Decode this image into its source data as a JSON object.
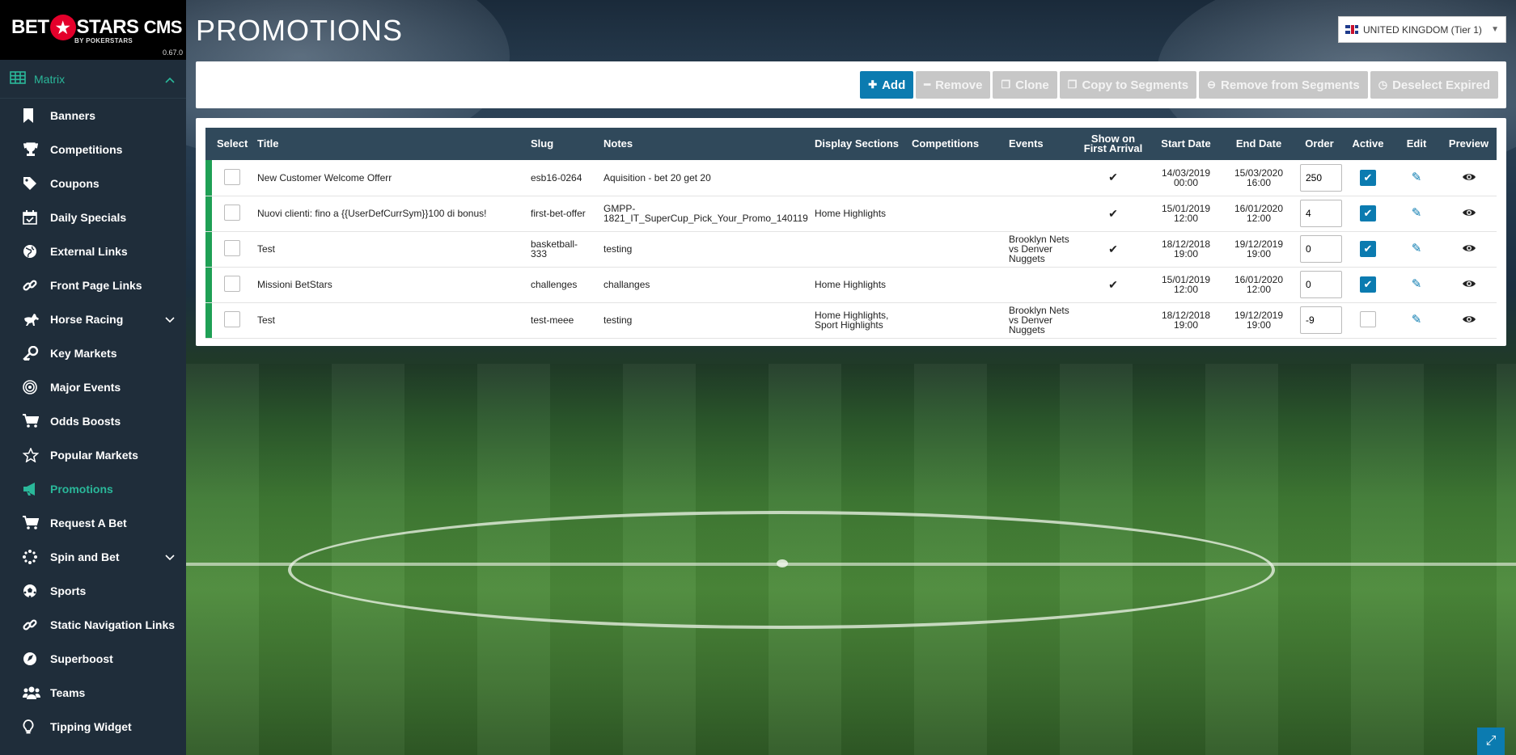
{
  "brand": {
    "bet": "BET",
    "star": "★",
    "stars": "STARS",
    "cms": "CMS",
    "sub": "BY POKERSTARS",
    "version": "0.67.0"
  },
  "sidebar": {
    "matrix_label": "Matrix",
    "items": [
      {
        "label": "Banners",
        "icon": "bookmark-icon"
      },
      {
        "label": "Competitions",
        "icon": "trophy-icon"
      },
      {
        "label": "Coupons",
        "icon": "tag-icon"
      },
      {
        "label": "Daily Specials",
        "icon": "calendar-check-icon"
      },
      {
        "label": "External Links",
        "icon": "globe-icon"
      },
      {
        "label": "Front Page Links",
        "icon": "link-icon"
      },
      {
        "label": "Horse Racing",
        "icon": "horse-icon"
      },
      {
        "label": "Key Markets",
        "icon": "key-icon"
      },
      {
        "label": "Major Events",
        "icon": "bullseye-icon"
      },
      {
        "label": "Odds Boosts",
        "icon": "cart-icon"
      },
      {
        "label": "Popular Markets",
        "icon": "star-outline-icon"
      },
      {
        "label": "Promotions",
        "icon": "megaphone-icon"
      },
      {
        "label": "Request A Bet",
        "icon": "cart-icon"
      },
      {
        "label": "Spin and Bet",
        "icon": "spinner-icon"
      },
      {
        "label": "Sports",
        "icon": "soccer-ball-icon"
      },
      {
        "label": "Static Navigation Links",
        "icon": "link-icon"
      },
      {
        "label": "Superboost",
        "icon": "rocket-icon"
      },
      {
        "label": "Teams",
        "icon": "users-icon"
      },
      {
        "label": "Tipping Widget",
        "icon": "lightbulb-icon"
      }
    ]
  },
  "page": {
    "title": "PROMOTIONS"
  },
  "country": {
    "selected": "UNITED KINGDOM (Tier 1)"
  },
  "toolbar": {
    "add": "Add",
    "remove": "Remove",
    "clone": "Clone",
    "copy_to_segments": "Copy to Segments",
    "remove_from_segments": "Remove from Segments",
    "deselect_expired": "Deselect Expired"
  },
  "table": {
    "headers": {
      "select": "Select",
      "title": "Title",
      "slug": "Slug",
      "notes": "Notes",
      "display_sections": "Display Sections",
      "competitions": "Competitions",
      "events": "Events",
      "show_on_first_arrival_1": "Show on",
      "show_on_first_arrival_2": "First Arrival",
      "start_date": "Start Date",
      "end_date": "End Date",
      "order": "Order",
      "active": "Active",
      "edit": "Edit",
      "preview": "Preview"
    },
    "rows": [
      {
        "title": "New Customer Welcome Offerr",
        "slug": "esb16-0264",
        "notes_1": "Aquisition - bet 20 get 20",
        "notes_2": "",
        "display_1": "",
        "display_2": "",
        "competitions": "",
        "events_1": "",
        "events_2": "",
        "events_3": "",
        "first_arrival": "✔",
        "start_1": "14/03/2019",
        "start_2": "00:00",
        "end_1": "15/03/2020",
        "end_2": "16:00",
        "order": "250",
        "active": true
      },
      {
        "title": "Nuovi clienti: fino a {{UserDefCurrSym}}100 di bonus!",
        "slug": "first-bet-offer",
        "notes_1": "GMPP-",
        "notes_2": "1821_IT_SuperCup_Pick_Your_Promo_140119",
        "display_1": "Home Highlights",
        "display_2": "",
        "competitions": "",
        "events_1": "",
        "events_2": "",
        "events_3": "",
        "first_arrival": "✔",
        "start_1": "15/01/2019",
        "start_2": "12:00",
        "end_1": "16/01/2020",
        "end_2": "12:00",
        "order": "4",
        "active": true
      },
      {
        "title": "Test",
        "slug": "basketball-333",
        "notes_1": "testing",
        "notes_2": "",
        "display_1": "",
        "display_2": "",
        "competitions": "",
        "events_1": "Brooklyn Nets",
        "events_2": "vs Denver",
        "events_3": "Nuggets",
        "first_arrival": "✔",
        "start_1": "18/12/2018",
        "start_2": "19:00",
        "end_1": "19/12/2019",
        "end_2": "19:00",
        "order": "0",
        "active": true
      },
      {
        "title": "Missioni BetStars",
        "slug": "challenges",
        "notes_1": "challanges",
        "notes_2": "",
        "display_1": "Home Highlights",
        "display_2": "",
        "competitions": "",
        "events_1": "",
        "events_2": "",
        "events_3": "",
        "first_arrival": "✔",
        "start_1": "15/01/2019",
        "start_2": "12:00",
        "end_1": "16/01/2020",
        "end_2": "12:00",
        "order": "0",
        "active": true
      },
      {
        "title": "Test",
        "slug": "test-meee",
        "notes_1": "testing",
        "notes_2": "",
        "display_1": "Home Highlights,",
        "display_2": "Sport Highlights",
        "competitions": "",
        "events_1": "Brooklyn Nets",
        "events_2": "vs Denver",
        "events_3": "Nuggets",
        "first_arrival": "",
        "start_1": "18/12/2018",
        "start_2": "19:00",
        "end_1": "19/12/2019",
        "end_2": "19:00",
        "order": "-9",
        "active": false
      }
    ]
  },
  "colors": {
    "sidebar_bg": "#1f2d3a",
    "accent_teal": "#2ab89a",
    "primary_blue": "#0b7bb0",
    "table_header": "#30495b",
    "row_bar_green": "#1fa055",
    "brand_red": "#e4002b"
  }
}
